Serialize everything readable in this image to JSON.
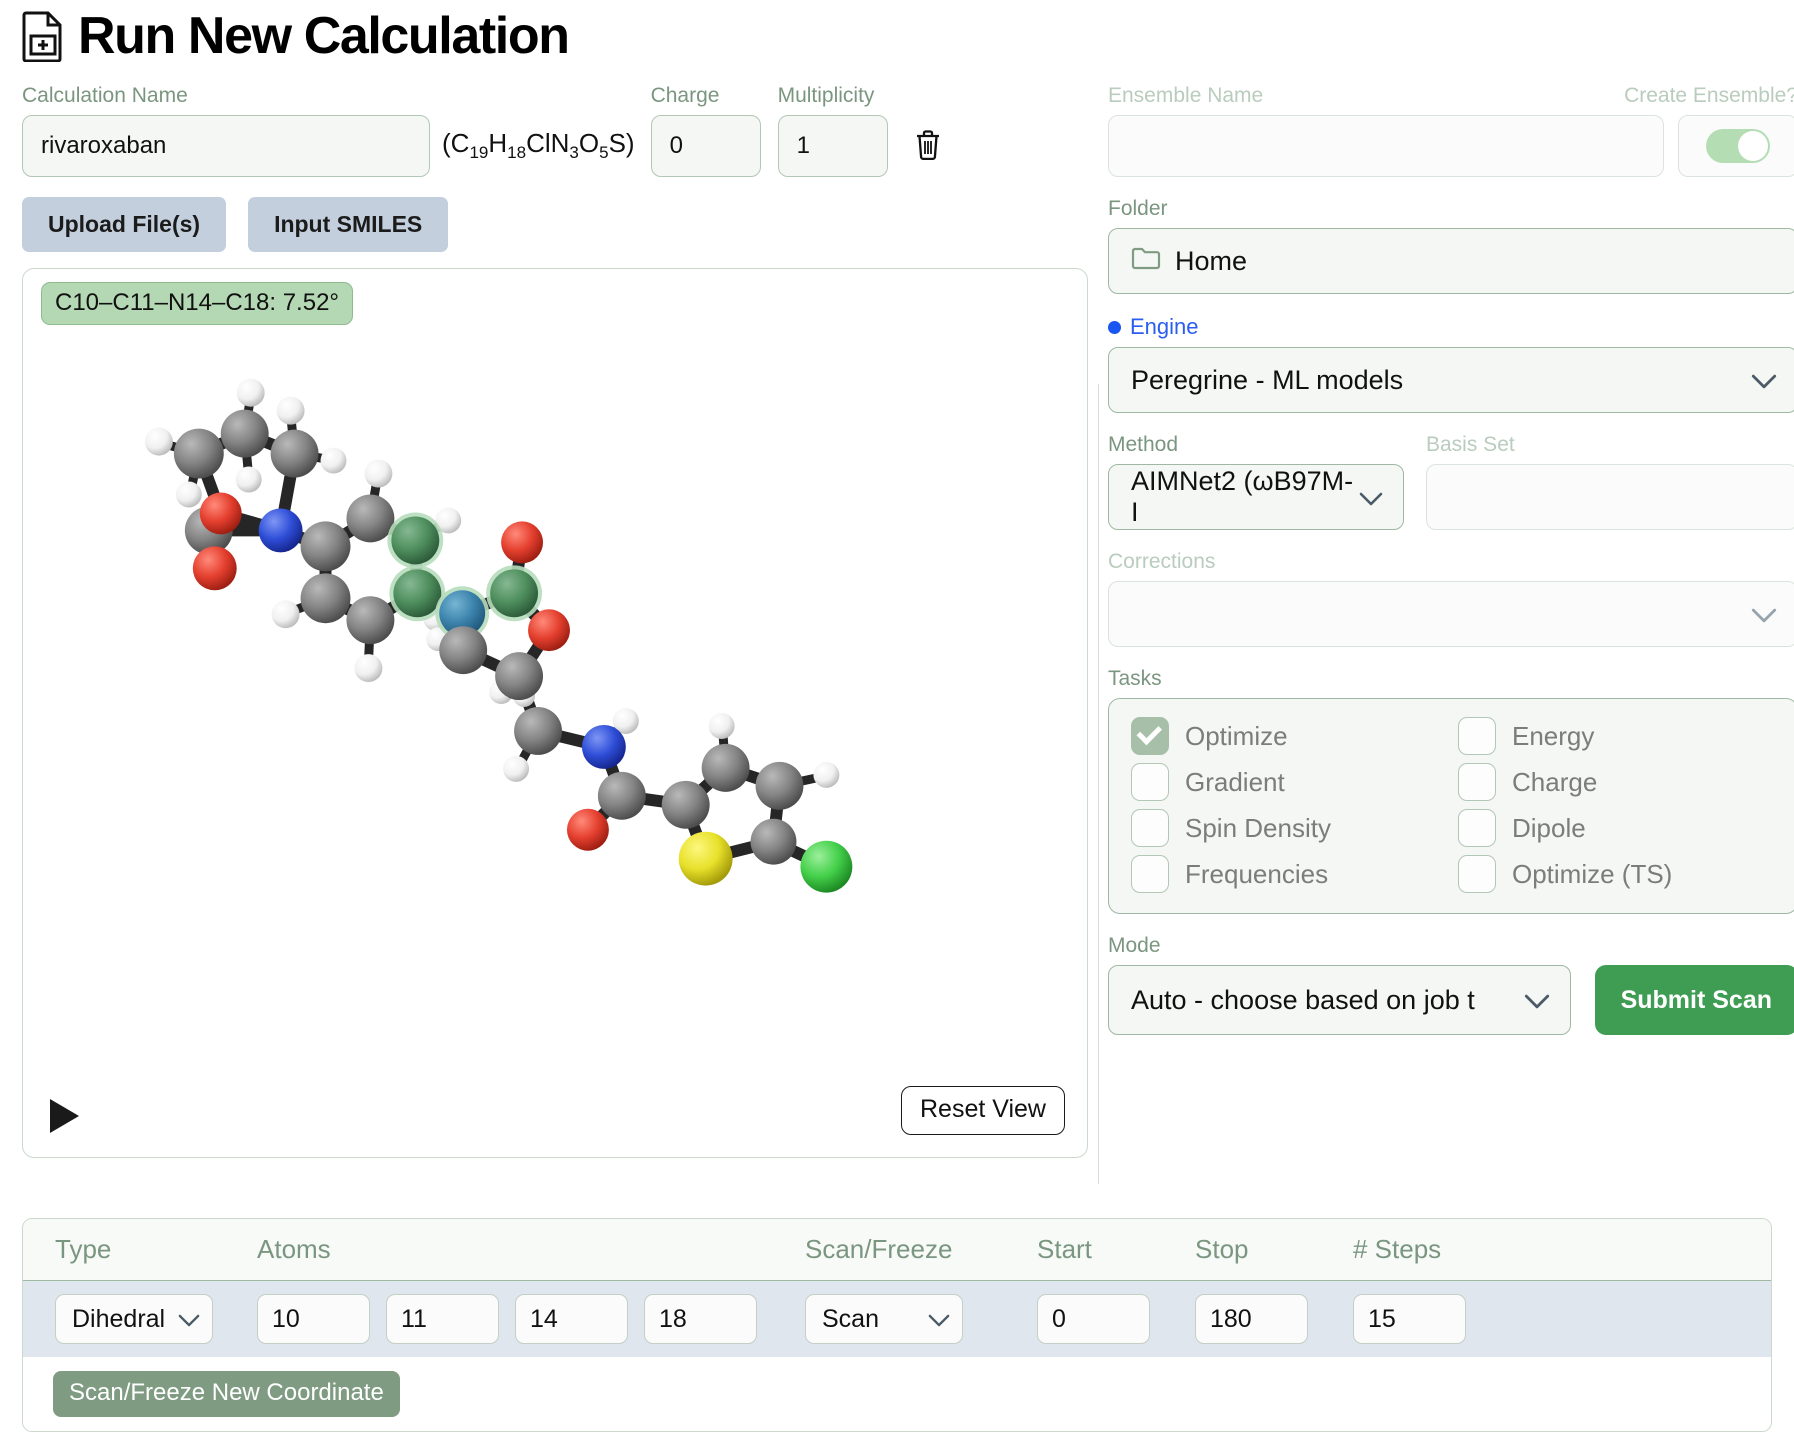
{
  "header": {
    "title": "Run New Calculation",
    "icon": "document-plus-icon"
  },
  "form": {
    "calculation_name_label": "Calculation Name",
    "calculation_name_value": "rivaroxaban",
    "formula": "(C19H18ClN3O5S)",
    "charge_label": "Charge",
    "charge_value": "0",
    "multiplicity_label": "Multiplicity",
    "multiplicity_value": "1",
    "delete_icon": "trash-icon",
    "upload_button": "Upload File(s)",
    "smiles_button": "Input SMILES"
  },
  "viewer": {
    "dihedral_badge": "C10–C11–N14–C18: 7.52°",
    "play_icon": "play-icon",
    "reset_button": "Reset View"
  },
  "right": {
    "ensemble_name_label": "Ensemble Name",
    "ensemble_name_value": "",
    "create_ensemble_label": "Create Ensemble?",
    "create_ensemble_on": true,
    "folder_label": "Folder",
    "folder_value": "Home",
    "folder_icon": "folder-icon",
    "engine_label": "Engine",
    "engine_value": "Peregrine - ML models",
    "method_label": "Method",
    "method_value": "AIMNet2 (ωB97M-I",
    "basis_set_label": "Basis Set",
    "basis_set_value": "",
    "corrections_label": "Corrections",
    "corrections_value": "",
    "tasks_label": "Tasks",
    "tasks": [
      {
        "label": "Optimize",
        "checked": true
      },
      {
        "label": "Energy",
        "checked": false
      },
      {
        "label": "Gradient",
        "checked": false
      },
      {
        "label": "Charge",
        "checked": false
      },
      {
        "label": "Spin Density",
        "checked": false
      },
      {
        "label": "Dipole",
        "checked": false
      },
      {
        "label": "Frequencies",
        "checked": false
      },
      {
        "label": "Optimize (TS)",
        "checked": false
      }
    ],
    "mode_label": "Mode",
    "mode_value": "Auto - choose based on job t",
    "submit_button": "Submit Scan"
  },
  "coordinates": {
    "headers": {
      "type": "Type",
      "atoms": "Atoms",
      "scan_freeze": "Scan/Freeze",
      "start": "Start",
      "stop": "Stop",
      "steps": "# Steps"
    },
    "row": {
      "type": "Dihedral",
      "atoms": [
        "10",
        "11",
        "14",
        "18"
      ],
      "scan_freeze": "Scan",
      "start": "0",
      "stop": "180",
      "steps": "15"
    },
    "add_button": "Scan/Freeze New Coordinate"
  },
  "colors": {
    "accent_green": "#3f9d53",
    "label_green": "#7b9680",
    "engine_blue": "#2b5ef0",
    "badge_green": "#b3d8b3",
    "row_blue": "#dfe6ee",
    "button_blue_grey": "#c3cfdd",
    "checkbox_green": "#a7bfa9",
    "add_coord_green": "#7f9b82"
  },
  "molecule": {
    "name": "rivaroxaban-3d-ball-and-stick",
    "atom_colors": {
      "carbon": "#808080",
      "hydrogen": "#f2f2f2",
      "oxygen": "#e03b2e",
      "nitrogen": "#2f4fd8",
      "sulfur": "#e8e12b",
      "chlorine": "#44d04a",
      "highlight_green": "#4f8f5e",
      "highlight_blue": "#3d84ad"
    }
  }
}
